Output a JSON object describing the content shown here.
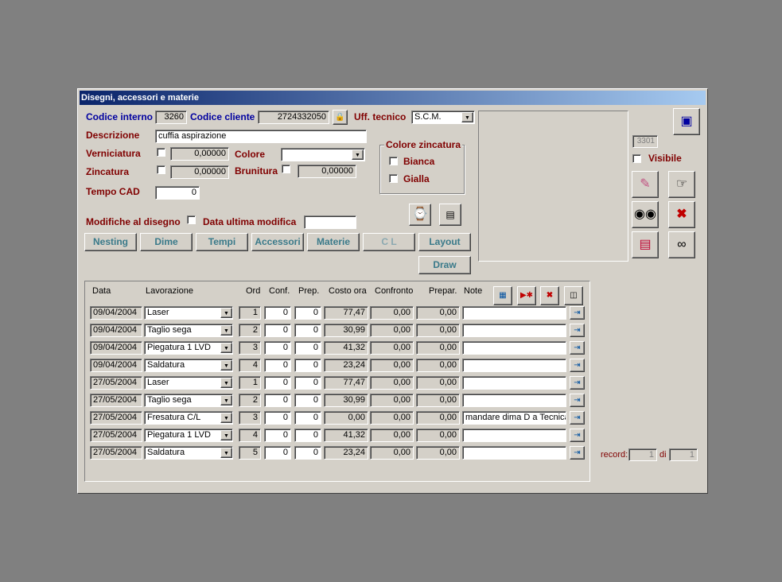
{
  "window": {
    "title": "Disegni, accessori e materie"
  },
  "header": {
    "codice_interno_label": "Codice interno",
    "codice_interno": "3260",
    "codice_cliente_label": "Codice cliente",
    "codice_cliente": "2724332050",
    "uff_tecnico_label": "Uff. tecnico",
    "uff_tecnico": "S.C.M.",
    "descrizione_label": "Descrizione",
    "descrizione": "cuffia aspirazione",
    "verniciatura_label": "Verniciatura",
    "verniciatura_value": "0,00000",
    "colore_label": "Colore",
    "colore_value": "",
    "zincatura_label": "Zincatura",
    "zincatura_value": "0,00000",
    "brunitura_label": "Brunitura",
    "brunitura_value": "0,00000",
    "colore_zincatura_label": "Colore zincatura",
    "bianca_label": "Bianca",
    "gialla_label": "Gialla",
    "tempo_cad_label": "Tempo CAD",
    "tempo_cad": "0",
    "modifiche_label": "Modifiche al disegno",
    "data_ultima_label": "Data ultima modifica",
    "data_ultima": ""
  },
  "buttons": {
    "nesting": "Nesting",
    "dime": "Dime",
    "tempi": "Tempi",
    "accessori": "Accessori",
    "materie": "Materie",
    "cl": "C L",
    "layout": "Layout",
    "draw": "Draw"
  },
  "side": {
    "counter": "3301",
    "visibile_label": "Visibile"
  },
  "grid": {
    "columns": [
      "Data",
      "Lavorazione",
      "Ord",
      "Conf.",
      "Prep.",
      "Costo ora",
      "Confronto",
      "Prepar.",
      "Note"
    ],
    "rows": [
      {
        "data": "09/04/2004",
        "lav": "Laser",
        "ord": "1",
        "conf": "0",
        "prep": "0",
        "costo": "77,47",
        "confronto": "0,00",
        "prepar": "0,00",
        "note": ""
      },
      {
        "data": "09/04/2004",
        "lav": "Taglio sega",
        "ord": "2",
        "conf": "0",
        "prep": "0",
        "costo": "30,99",
        "confronto": "0,00",
        "prepar": "0,00",
        "note": ""
      },
      {
        "data": "09/04/2004",
        "lav": "Piegatura 1 LVD",
        "ord": "3",
        "conf": "0",
        "prep": "0",
        "costo": "41,32",
        "confronto": "0,00",
        "prepar": "0,00",
        "note": ""
      },
      {
        "data": "09/04/2004",
        "lav": "Saldatura",
        "ord": "4",
        "conf": "0",
        "prep": "0",
        "costo": "23,24",
        "confronto": "0,00",
        "prepar": "0,00",
        "note": ""
      },
      {
        "data": "27/05/2004",
        "lav": "Laser",
        "ord": "1",
        "conf": "0",
        "prep": "0",
        "costo": "77,47",
        "confronto": "0,00",
        "prepar": "0,00",
        "note": ""
      },
      {
        "data": "27/05/2004",
        "lav": "Taglio sega",
        "ord": "2",
        "conf": "0",
        "prep": "0",
        "costo": "30,99",
        "confronto": "0,00",
        "prepar": "0,00",
        "note": ""
      },
      {
        "data": "27/05/2004",
        "lav": "Fresatura C/L",
        "ord": "3",
        "conf": "0",
        "prep": "0",
        "costo": "0,00",
        "confronto": "0,00",
        "prepar": "0,00",
        "note": "mandare dima D a Tecnica"
      },
      {
        "data": "27/05/2004",
        "lav": "Piegatura 1 LVD",
        "ord": "4",
        "conf": "0",
        "prep": "0",
        "costo": "41,32",
        "confronto": "0,00",
        "prepar": "0,00",
        "note": ""
      },
      {
        "data": "27/05/2004",
        "lav": "Saldatura",
        "ord": "5",
        "conf": "0",
        "prep": "0",
        "costo": "23,24",
        "confronto": "0,00",
        "prepar": "0,00",
        "note": ""
      }
    ]
  },
  "record": {
    "label": "record:",
    "current": "1",
    "di_label": "di",
    "total": "1"
  },
  "colors": {
    "label_blue": "#0000a0",
    "label_red": "#800000",
    "button_text": "#3a7a8a",
    "titlebar": "#0a246a"
  }
}
